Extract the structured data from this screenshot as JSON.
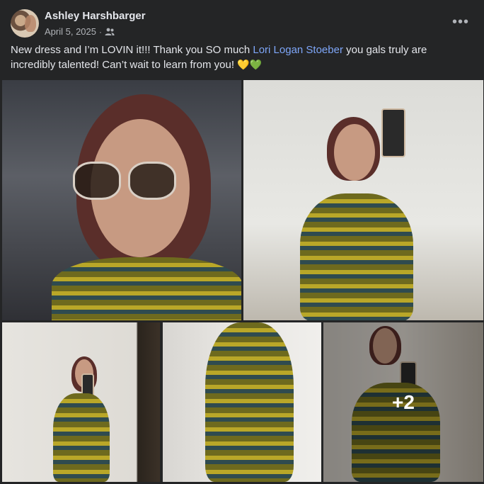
{
  "post": {
    "author": "Ashley Harshbarger",
    "date": "April 5, 2025",
    "separator": "·",
    "audience_icon": "friends-icon",
    "more_icon": "more-horizontal-icon",
    "more_label": "•••",
    "caption_before": "New dress and I’m LOVIN it!!! Thank you SO much ",
    "caption_link": "Lori Logan Stoeber",
    "caption_after": " you gals truly are incredibly talented! Can’t wait to learn from you! ",
    "caption_emoji": "💛💚",
    "photos": [
      {
        "name": "car-selfie"
      },
      {
        "name": "mirror-selfie-front"
      },
      {
        "name": "mirror-full-length"
      },
      {
        "name": "back-view"
      },
      {
        "name": "mirror-side"
      }
    ],
    "more_photos_label": "+2"
  },
  "colors": {
    "background": "#242526",
    "text": "#e4e6eb",
    "secondary_text": "#b0b3b8",
    "link": "#7ea6f8"
  }
}
